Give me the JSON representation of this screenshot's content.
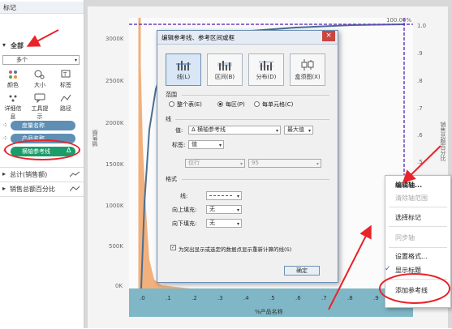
{
  "left_panel": {
    "section_label": "标记",
    "all_label": "全部",
    "mark_type": "多个",
    "mark_buttons": [
      "颜色",
      "大小",
      "标签",
      "详细信息",
      "工具提示",
      "路径"
    ],
    "pills": [
      "度量名称",
      "产品名称",
      "横轴参考线"
    ],
    "measures": [
      "总计(销售额)",
      "销售总额百分比"
    ]
  },
  "chart": {
    "y_ticks": [
      "3000K",
      "2500K",
      "2000K",
      "1500K",
      "1000K",
      "500K",
      "0K"
    ],
    "y_label": "销售额",
    "y2_ticks": [
      "1.0",
      ".9",
      ".8",
      ".7",
      ".6",
      ".5"
    ],
    "y2_label": "销售总额百分比",
    "x_ticks": [
      ".0",
      ".1",
      ".2",
      ".3",
      ".4",
      ".5",
      ".6",
      ".7",
      ".8",
      ".9"
    ],
    "x_label": "%产品名称",
    "ref_label": "100.00%",
    "colors": {
      "area": "#f2b07c",
      "line": "#4a6f93",
      "refline": "#6a3fbf",
      "band": "#7fb7c7"
    }
  },
  "dialog": {
    "title": "编辑参考线、参考区间或框",
    "close": "×",
    "types": [
      "线(L)",
      "区间(B)",
      "分布(D)",
      "盒须图(X)"
    ],
    "scope_label": "范围",
    "scope_options": [
      "整个表(E)",
      "每区(P)",
      "每单元格(C)"
    ],
    "line_section": "线",
    "value_label": "值:",
    "value_field": "Δ 横轴参考线",
    "value_agg": "最大值",
    "tag_label": "标签:",
    "tag_value": "值",
    "disabled_left": "仅行",
    "disabled_right": "95",
    "format_section": "格式",
    "line_label": "线:",
    "fill_above_label": "向上填充:",
    "fill_above_value": "无",
    "fill_below_label": "向下填充:",
    "fill_below_value": "无",
    "checkbox_label": "为突出显示或选定的数据点显示重新计算的线(S)",
    "ok": "确定"
  },
  "menu": {
    "items": [
      "编辑轴...",
      "清除轴范围",
      "选择标记",
      "同步轴",
      "设置格式...",
      "显示标题",
      "添加参考线"
    ]
  }
}
